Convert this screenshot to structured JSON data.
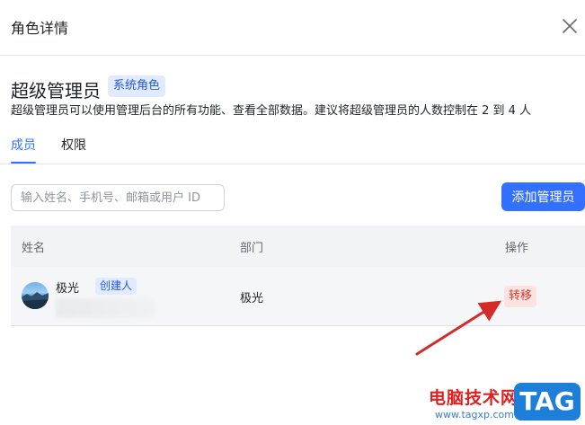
{
  "header": {
    "title": "角色详情"
  },
  "role": {
    "name": "超级管理员",
    "badge": "系统角色",
    "description": "超级管理员可以使用管理后台的所有功能、查看全部数据。建议将超级管理员的人数控制在 2 到 4 人"
  },
  "tabs": [
    {
      "label": "成员",
      "active": true
    },
    {
      "label": "权限",
      "active": false
    }
  ],
  "search": {
    "placeholder": "输入姓名、手机号、邮箱或用户 ID",
    "value": ""
  },
  "add_button_label": "添加管理员",
  "table": {
    "columns": [
      "姓名",
      "部门",
      "操作"
    ],
    "rows": [
      {
        "name": "极光",
        "tag": "创建人",
        "department": "极光",
        "action": "转移"
      }
    ]
  },
  "watermark": {
    "text": "电脑技术网",
    "url": "www.tagxp.com",
    "logo": "TAG"
  },
  "colors": {
    "accent": "#3370ff",
    "danger": "#d83931",
    "arrow": "#d42a2a"
  }
}
